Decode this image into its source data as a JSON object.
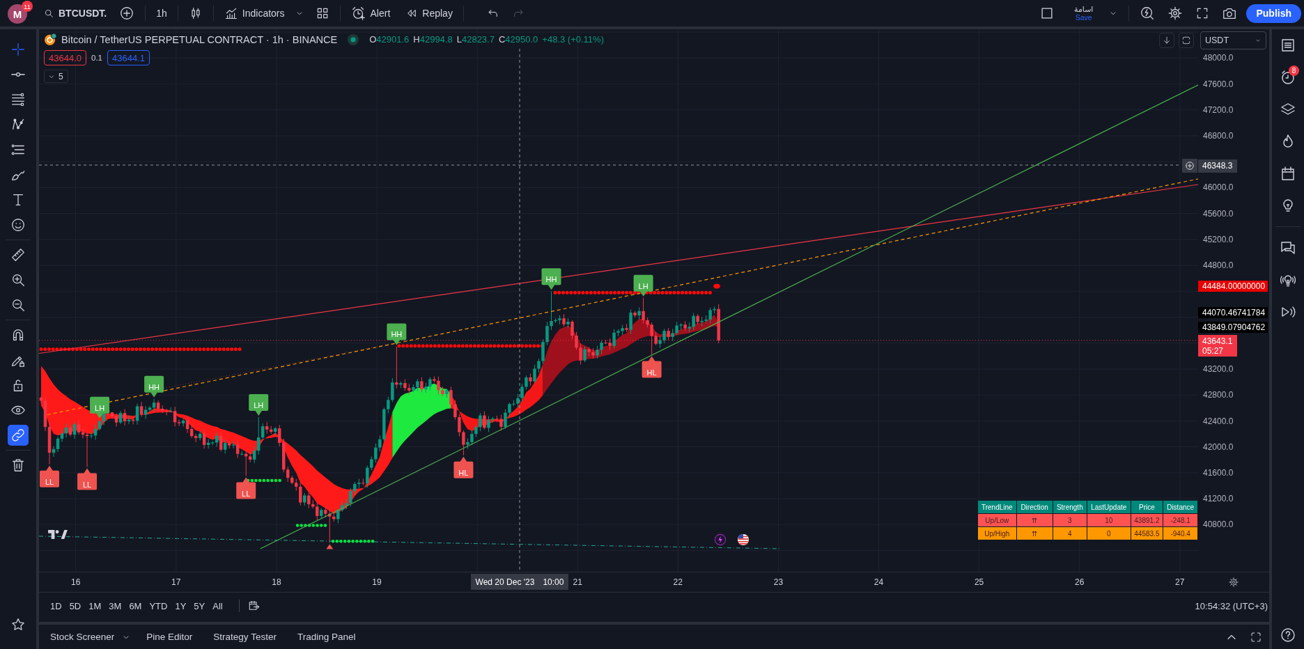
{
  "top_bar": {
    "avatar": {
      "letter": "M",
      "badge": "11"
    },
    "symbol": "BTCUSDT.",
    "interval": "1h",
    "indicators": "Indicators",
    "alert": "Alert",
    "replay": "Replay",
    "history": [
      {
        "kind": "undo",
        "disabled": false
      },
      {
        "kind": "redo",
        "disabled": true
      }
    ],
    "layout": {
      "name": "اسامة",
      "action": "Save"
    },
    "publish": "Publish"
  },
  "left_toolbar": {
    "drawing_tools": [
      {
        "selected": true
      },
      {
        "selected": false
      },
      {
        "selected": false
      },
      {
        "selected": false
      },
      {
        "selected": false
      },
      {
        "selected": false
      },
      {
        "selected": false
      },
      {
        "selected": false
      }
    ],
    "toggles": [
      {
        "on": false
      },
      {
        "on": false
      },
      {
        "on": false
      },
      {
        "on": false
      },
      {
        "on": true
      }
    ]
  },
  "chart": {
    "title": "Bitcoin / TetherUS PERPETUAL CONTRACT · 1h · BINANCE",
    "ohlc": [
      {
        "key": "O",
        "value": "42901.6"
      },
      {
        "key": "H",
        "value": "42994.8"
      },
      {
        "key": "L",
        "value": "42823.7"
      },
      {
        "key": "C",
        "value": "42950.0"
      }
    ],
    "change": "+48.3 (+0.11%)",
    "sell_price": "43644.0",
    "spread": "0.1",
    "buy_price": "43644.1",
    "indicator_count": "5",
    "currency": "USDT",
    "swing_labels": [
      {
        "text": "LL",
        "kind": "low"
      },
      {
        "text": "LL",
        "kind": "low"
      },
      {
        "text": "LH",
        "kind": "high"
      },
      {
        "text": "HH",
        "kind": "high"
      },
      {
        "text": "LL",
        "kind": "low"
      },
      {
        "text": "LH",
        "kind": "high"
      },
      {
        "text": "HH",
        "kind": "high"
      },
      {
        "text": "HL",
        "kind": "low"
      },
      {
        "text": "HH",
        "kind": "high"
      },
      {
        "text": "LH",
        "kind": "high"
      },
      {
        "text": "HL",
        "kind": "low"
      }
    ],
    "trend_table": {
      "columns": [
        "TrendLine",
        "Direction",
        "Strength",
        "LastUpdate",
        "Price",
        "Distance"
      ],
      "rows": [
        {
          "color": "#ff5252",
          "cells": [
            "Up/Low",
            "⇈",
            "3",
            "10",
            "43891.2",
            "-248.1"
          ]
        },
        {
          "color": "#ff9800",
          "cells": [
            "Up/High",
            "⇈",
            "4",
            "0",
            "44583.5",
            "-940.4"
          ]
        }
      ]
    }
  },
  "price_axis": {
    "labels": [
      "48000.0",
      "47600.0",
      "47200.0",
      "46800.0",
      "46000.0",
      "45600.0",
      "45200.0",
      "44800.0",
      "43200.0",
      "42800.0",
      "42400.0",
      "42000.0",
      "41600.0",
      "41200.0",
      "40800.0"
    ],
    "crosshair_price": "46348.3",
    "markers": [
      {
        "text": "44484.00000000",
        "color": "#e60000"
      },
      {
        "text": "44070.46741784",
        "color": "#000000"
      },
      {
        "text": "43849.07904762",
        "color": "#000000"
      }
    ],
    "last_price": "43643.1",
    "countdown": "05:27"
  },
  "time_axis": {
    "labels": [
      "16",
      "17",
      "18",
      "19",
      "21",
      "22",
      "23",
      "24",
      "25",
      "26",
      "27"
    ],
    "crosshair_date": "Wed 20 Dec '23",
    "crosshair_time": "10:00"
  },
  "range_bar": {
    "ranges": [
      "1D",
      "5D",
      "1M",
      "3M",
      "6M",
      "YTD",
      "1Y",
      "5Y",
      "All"
    ],
    "clock": "10:54:32 (UTC+3)"
  },
  "bottom_panel": {
    "tabs": [
      {
        "label": "Stock Screener",
        "kind": "dropdown"
      },
      {
        "label": "Pine Editor",
        "kind": "tab"
      },
      {
        "label": "Strategy Tester",
        "kind": "tab"
      },
      {
        "label": "Trading Panel",
        "kind": "tab"
      }
    ]
  },
  "right_sidebar": {
    "alerts_badge": "8"
  }
}
